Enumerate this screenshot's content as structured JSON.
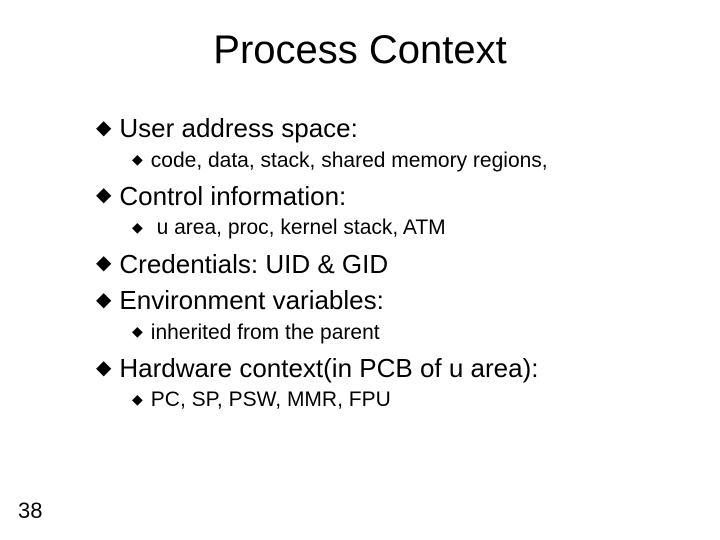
{
  "slide": {
    "title": "Process Context",
    "page_number": "38",
    "items": [
      {
        "level": 1,
        "text": "User address space:"
      },
      {
        "level": 2,
        "text": "code, data, stack, shared memory regions,"
      },
      {
        "level": 1,
        "text": "Control information:"
      },
      {
        "level": 2,
        "text": " u area, proc, kernel stack, ATM"
      },
      {
        "level": 1,
        "text": "Credentials: UID & GID"
      },
      {
        "level": 1,
        "text": "Environment variables:"
      },
      {
        "level": 2,
        "text": "inherited from the parent"
      },
      {
        "level": 1,
        "text": "Hardware context(in PCB of u area):"
      },
      {
        "level": 2,
        "text": "PC, SP, PSW, MMR, FPU"
      }
    ]
  },
  "bullet_glyph": "◆"
}
